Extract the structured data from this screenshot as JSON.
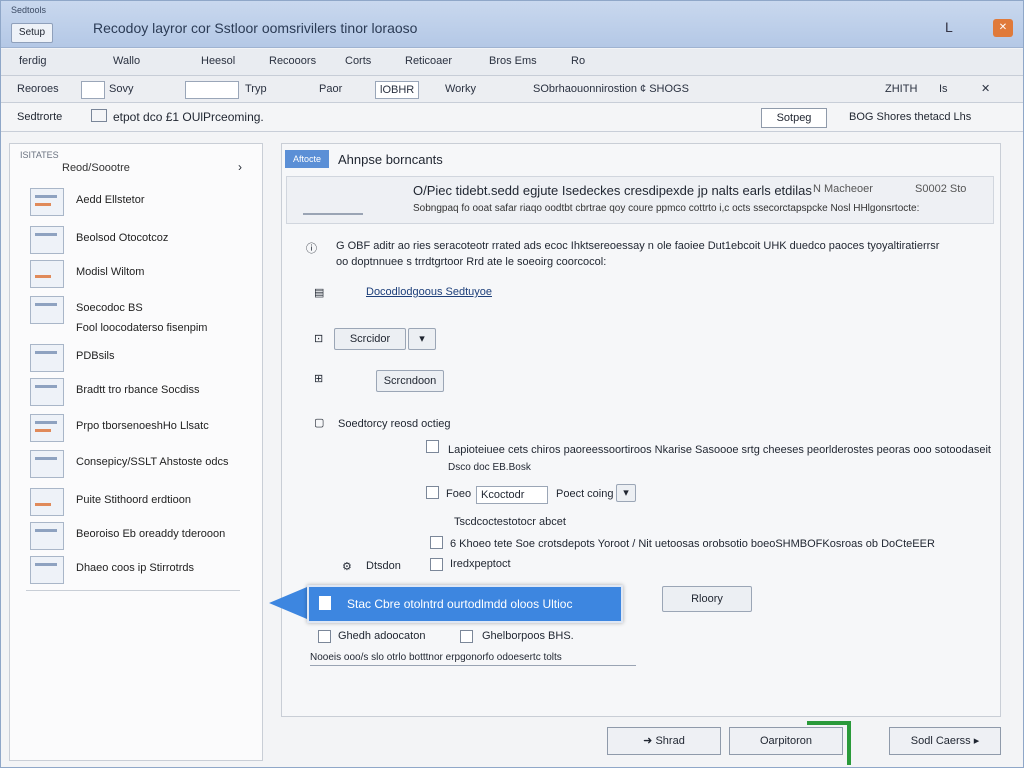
{
  "window": {
    "small_title": "Sedtools",
    "title_button": "Setup",
    "title": "Recodoy layror cor Sstloor oomsrivilers tinor loraoso",
    "minimize": "L"
  },
  "menu": [
    "ferdig",
    "Wallo",
    "Heesol",
    "Recooors",
    "Corts",
    "Reticoaer",
    "Bros Ems",
    "Ro"
  ],
  "ribbon": {
    "label": "Reoroes",
    "items": [
      "Sovy",
      "Tryp",
      "Paor",
      "lOBHR",
      "Worky"
    ],
    "status": "SObrhaouonnirostion ¢ SHOGS",
    "right1": "ZHITH",
    "right2": "Is"
  },
  "address": {
    "label": "Sedtrorte",
    "path": "etpot dco £1 OUlPrceoming.",
    "button": "Sotpeg",
    "right": "BOG Shores thetacd Lhs"
  },
  "sidebar": {
    "header": "ISITATES",
    "subheader": "Reod/Soootre",
    "items": [
      {
        "label": "Aedd Ellstetor"
      },
      {
        "label": "Beolsod Otocotcoz"
      },
      {
        "label": "Modisl Wiltom"
      },
      {
        "label": "Soecodoc BS"
      },
      {
        "label": "Fool loocodaterso fisenpim"
      },
      {
        "label": "PDBsils"
      },
      {
        "label": "Bradtt tro rbance Socdiss"
      },
      {
        "label": "Prpo tborsenoeshHo Llsatc"
      },
      {
        "label": "Consepicy/SSLT Ahstoste odcs"
      },
      {
        "label": "Puite Stithoord erdtioon"
      },
      {
        "label": "Beoroiso Eb oreaddy tderooon"
      },
      {
        "label": "Dhaeo coos ip Stirrotrds"
      }
    ]
  },
  "main": {
    "section_tag": "Aftocte",
    "section_title": "Ahnpse borncants",
    "banner": {
      "title": "O/Piec tidebt.sedd egjute Isedeckes cresdipexde jp nalts earls etdilas",
      "desc": "Sobngpaq fo ooat safar riaqo oodtbt cbrtrae qoy coure ppmco cottrto i,c octs ssecorctapspcke Nosl HHlgonsrtocte:",
      "right1": "N Macheoer",
      "right2": "S0002 Sto"
    },
    "intro_line1": "G OBF aditr ao ries seracoteotr rrated ads ecoc Ihktsereoessay n ole faoiee Dut1ebcoit UHK duedco paoces tyoyaltiratierrsr",
    "intro_line2": "oo doptnnuee s trrdtgrtoor Rrd ate le soeoirg coorcocol:",
    "link1": "Docodlodgoous Sedtuyoe",
    "btn_stretch": "Scrcidor",
    "btn_screenshot": "Scrcndoon",
    "subsection": "Soedtorcy reosd octieg",
    "opt1": "Lapioteiuee cets chiros paoreessoortiroos Nkarise Sasoooe srtg cheeses peorlderostes peoras ooo sotoodaseit",
    "opt1_sub": "Dsco doc EB.Bosk",
    "opt2_label": "Foeo",
    "opt2_field": "Kcoctodr",
    "opt2_field2": "Poect coing",
    "opt3_head": "Tscdcoctestotocr abcet",
    "opt3": "6 Khoeo tete Soe crotsdepots Yoroot / Nit uetoosas orobsotio boeoSHMBOFKosroas ob DoCteEER",
    "opt4": "Dtsdon",
    "opt4_b": "Iredxpeptoct",
    "preview_btn": "Rloory",
    "callout": "Stac Cbre otolntrd ourtodlmdd oloos Ultioc",
    "check_label": "Ghedh adoocaton",
    "check_right": "Ghelborpoos BHS.",
    "footnote": "Nooeis ooo/s slo otrlo botttnor erpgonorfo odoesertc tolts"
  },
  "footer": {
    "back": "Shrad",
    "options": "Oarpitoron",
    "next": "Sodl Caerss"
  }
}
